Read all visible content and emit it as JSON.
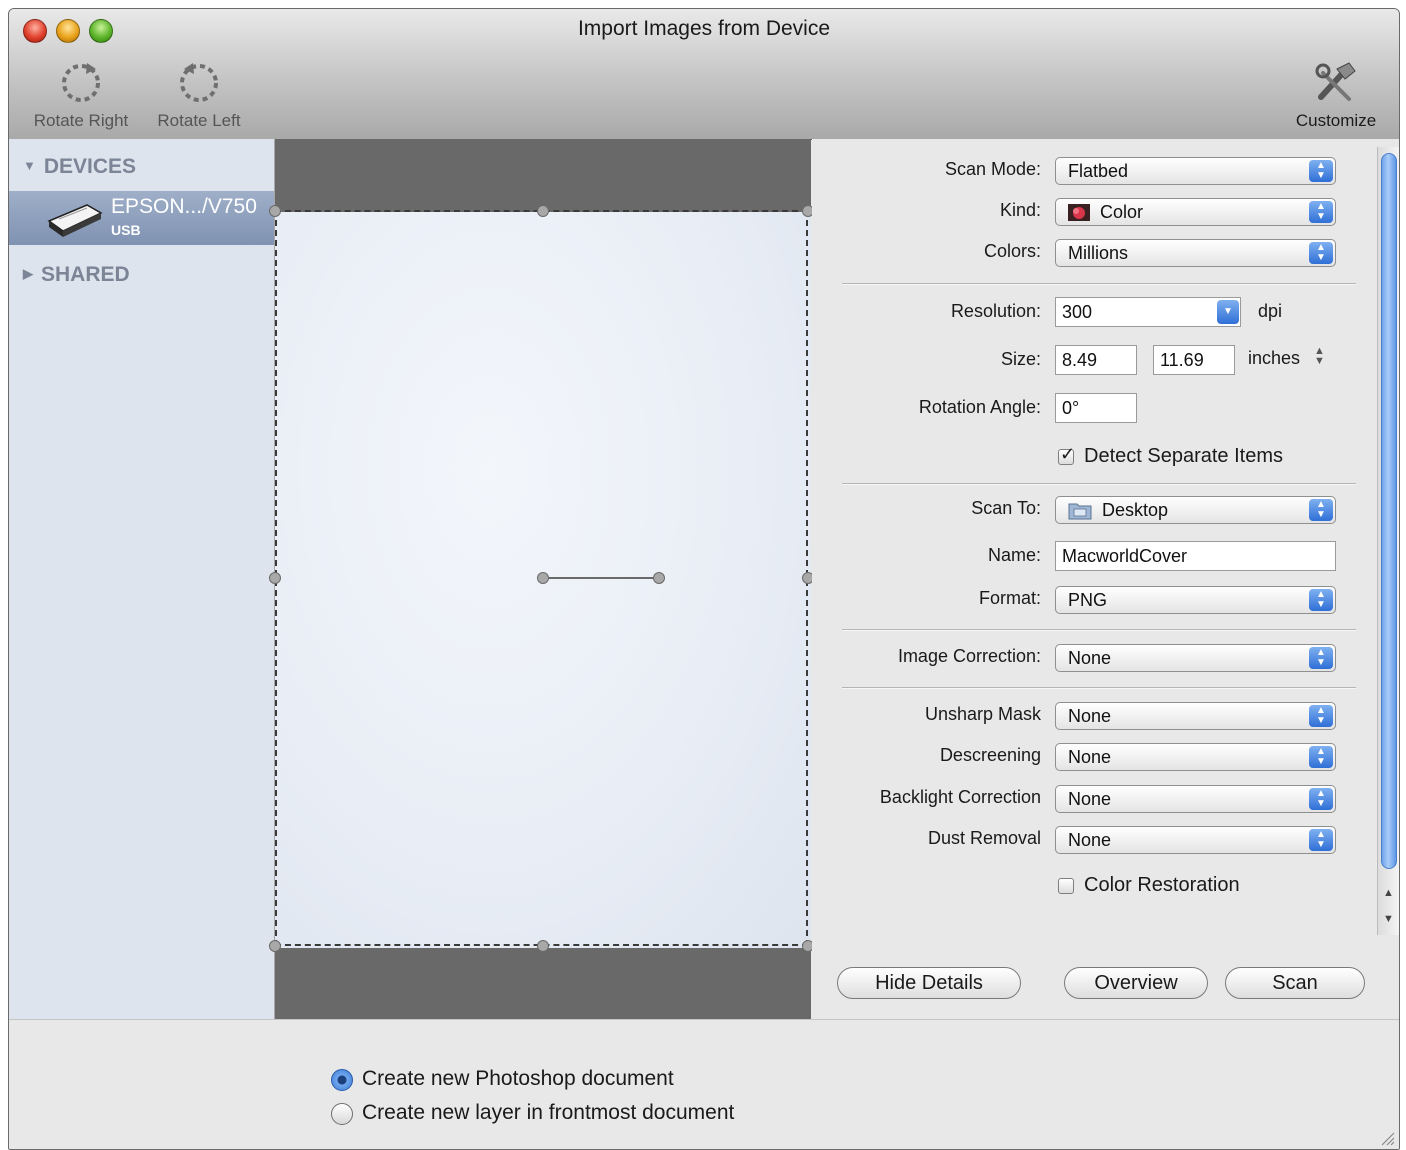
{
  "window": {
    "title": "Import Images from Device"
  },
  "toolbar": {
    "rotate_right": "Rotate Right",
    "rotate_left": "Rotate Left",
    "customize": "Customize"
  },
  "sidebar": {
    "devices_header": "DEVICES",
    "device": {
      "name": "EPSON.../V750",
      "connection": "USB"
    },
    "shared_header": "SHARED"
  },
  "settings": {
    "scan_mode": {
      "label": "Scan Mode:",
      "value": "Flatbed"
    },
    "kind": {
      "label": "Kind:",
      "value": "Color"
    },
    "colors": {
      "label": "Colors:",
      "value": "Millions"
    },
    "resolution": {
      "label": "Resolution:",
      "value": "300",
      "unit": "dpi"
    },
    "size": {
      "label": "Size:",
      "width": "8.49",
      "height": "11.69",
      "unit": "inches"
    },
    "rotation_angle": {
      "label": "Rotation Angle:",
      "value": "0°"
    },
    "detect_separate_items": {
      "label": "Detect Separate Items",
      "checked": true
    },
    "scan_to": {
      "label": "Scan To:",
      "value": "Desktop"
    },
    "name": {
      "label": "Name:",
      "value": "MacworldCover"
    },
    "format": {
      "label": "Format:",
      "value": "PNG"
    },
    "image_correction": {
      "label": "Image Correction:",
      "value": "None"
    },
    "unsharp_mask": {
      "label": "Unsharp Mask",
      "value": "None"
    },
    "descreening": {
      "label": "Descreening",
      "value": "None"
    },
    "backlight_correction": {
      "label": "Backlight Correction",
      "value": "None"
    },
    "dust_removal": {
      "label": "Dust Removal",
      "value": "None"
    },
    "color_restoration": {
      "label": "Color Restoration",
      "checked": false
    }
  },
  "buttons": {
    "hide_details": "Hide Details",
    "overview": "Overview",
    "scan": "Scan"
  },
  "destination": {
    "options": [
      {
        "label": "Create new Photoshop document",
        "selected": true
      },
      {
        "label": "Create new layer in frontmost document",
        "selected": false
      }
    ]
  },
  "colors": {
    "selection_blue": "#8fa2bf",
    "accent_blue": "#3b78d6",
    "preview_bg": "#696969"
  }
}
